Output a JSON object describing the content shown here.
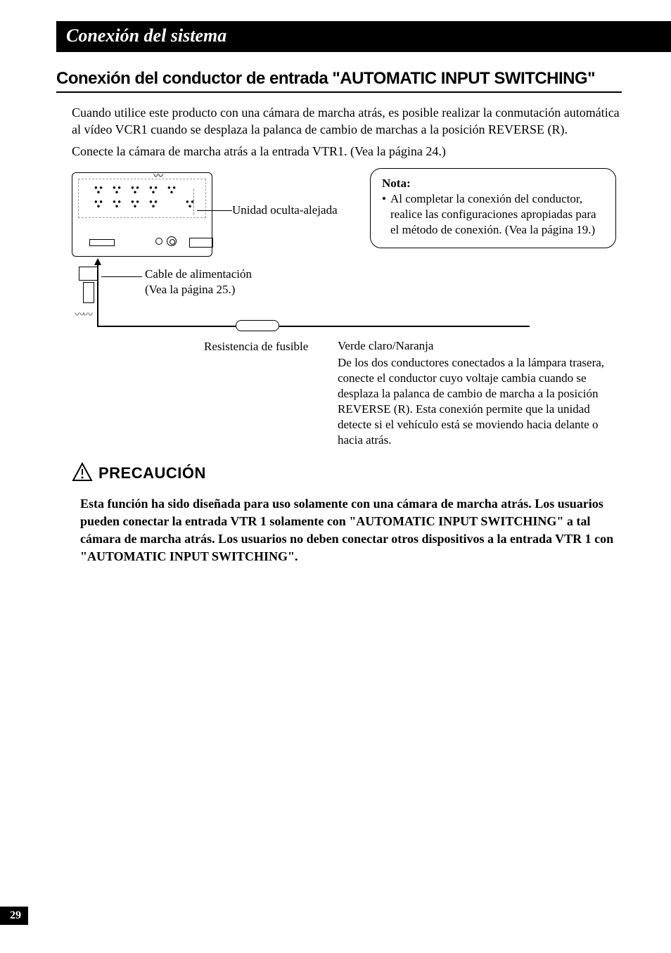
{
  "section_header": "Conexión del sistema",
  "subsection_title": "Conexión del conductor de entrada \"AUTOMATIC INPUT SWITCHING\"",
  "intro_p1": "Cuando utilice este producto con una cámara de marcha atrás, es posible realizar la conmutación automática al vídeo VCR1 cuando se desplaza la palanca de cambio de marchas a la posición REVERSE (R).",
  "intro_p2": "Conecte la cámara de marcha atrás a la entrada VTR1. (Vea la página 24.)",
  "diagram": {
    "unit_label": "Unidad oculta-alejada",
    "power_cable_line1": "Cable de alimentación",
    "power_cable_line2": "(Vea la página 25.)",
    "fuse_label": "Resistencia de fusible",
    "wire_color": "Verde claro/Naranja",
    "wire_desc": "De los dos conductores conectados a la lámpara trasera, conecte el conductor cuyo voltaje cambia cuando se desplaza la palanca de cambio de marcha a la posición REVERSE (R). Esta conexión permite que la unidad detecte si el vehículo está se moviendo hacia delante o hacia atrás."
  },
  "note": {
    "title": "Nota:",
    "bullet": "•",
    "text": "Al completar la conexión del conductor, realice las configuraciones apropiadas para el método de conexión. (Vea la página 19.)"
  },
  "caution": {
    "title": "PRECAUCIÓN",
    "body": "Esta función ha sido diseñada para uso solamente con una cámara de marcha atrás. Los usuarios pueden conectar la entrada VTR 1 solamente con \"AUTOMATIC INPUT SWITCHING\" a tal cámara de marcha atrás. Los usuarios no deben conectar otros dispositivos a la entrada VTR 1 con \"AUTOMATIC INPUT SWITCHING\"."
  },
  "page_number": "29"
}
